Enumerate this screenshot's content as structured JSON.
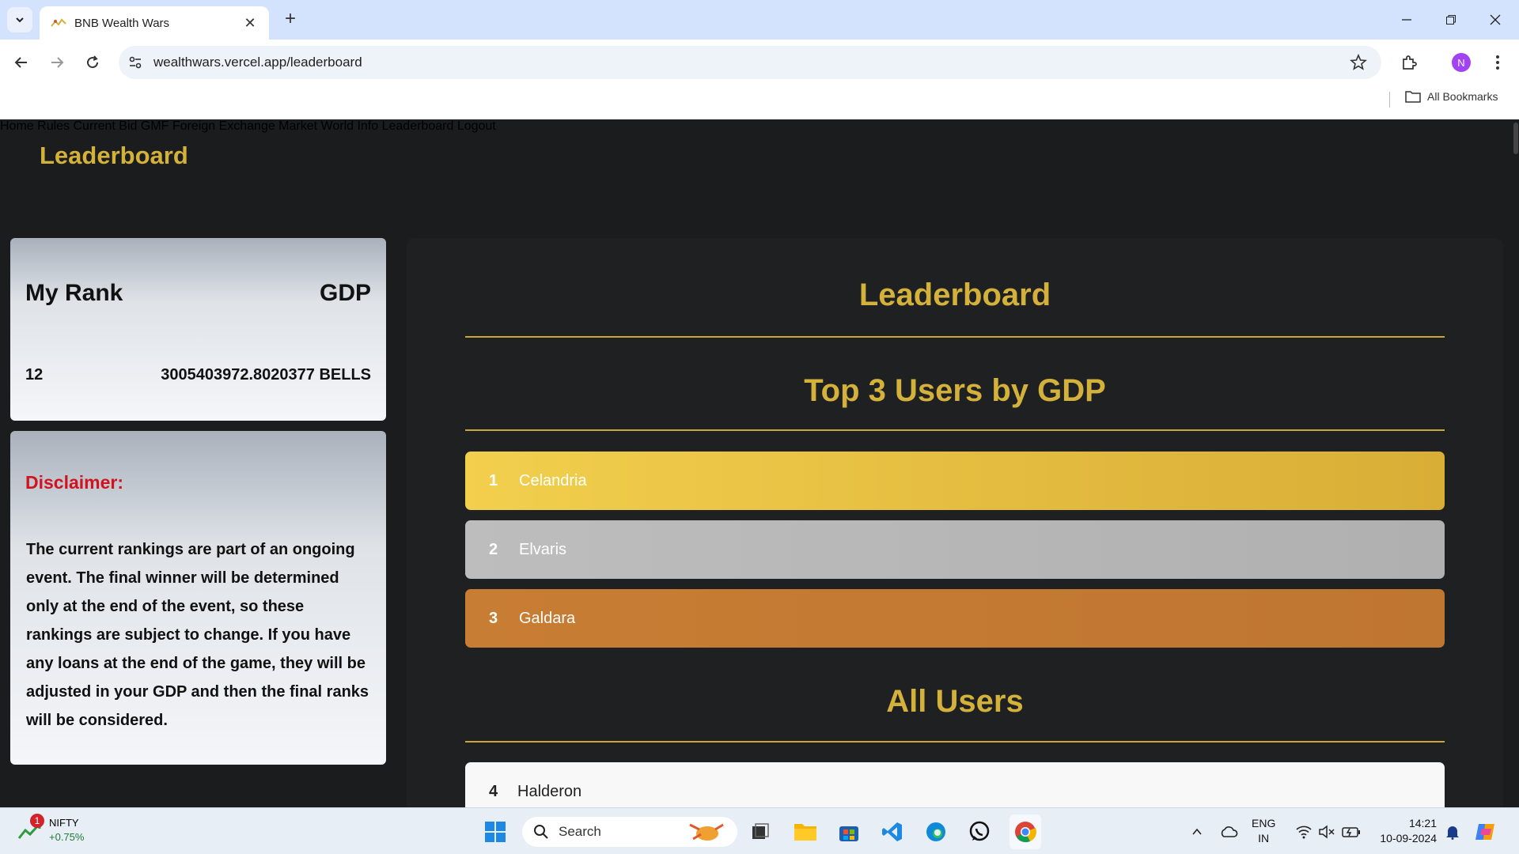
{
  "browser": {
    "tab_title": "BNB Wealth Wars",
    "url": "wealthwars.vercel.app/leaderboard",
    "profile_initial": "N",
    "bookmarks_label": "All Bookmarks"
  },
  "site": {
    "title": "Leaderboard",
    "nav": [
      "Home",
      "Rules",
      "Current Bid",
      "GMF",
      "Foreign Exchange Market",
      "World Info",
      "Leaderboard",
      "Logout"
    ]
  },
  "rank_card": {
    "rank_header": "My Rank",
    "gdp_header": "GDP",
    "rank": "12",
    "gdp": "3005403972.8020377 BELLS"
  },
  "disclaimer": {
    "title": "Disclaimer:",
    "text": "The current rankings are part of an ongoing event. The final winner will be determined only at the end of the event, so these rankings are subject to change. If you have any loans at the end of the game, they will be adjusted in your GDP and then the final ranks will be considered."
  },
  "board": {
    "heading": "Leaderboard",
    "top_heading": "Top 3 Users by GDP",
    "top_users": [
      {
        "rank": "1",
        "name": "Celandria"
      },
      {
        "rank": "2",
        "name": "Elvaris"
      },
      {
        "rank": "3",
        "name": "Galdara"
      }
    ],
    "all_heading": "All Users",
    "all_users": [
      {
        "rank": "4",
        "name": "Halderon"
      }
    ]
  },
  "taskbar": {
    "nifty_label": "NIFTY",
    "nifty_change": "+0.75%",
    "nifty_badge": "1",
    "search_label": "Search",
    "lang_line1": "ENG",
    "lang_line2": "IN",
    "time": "14:21",
    "date": "10-09-2024"
  }
}
